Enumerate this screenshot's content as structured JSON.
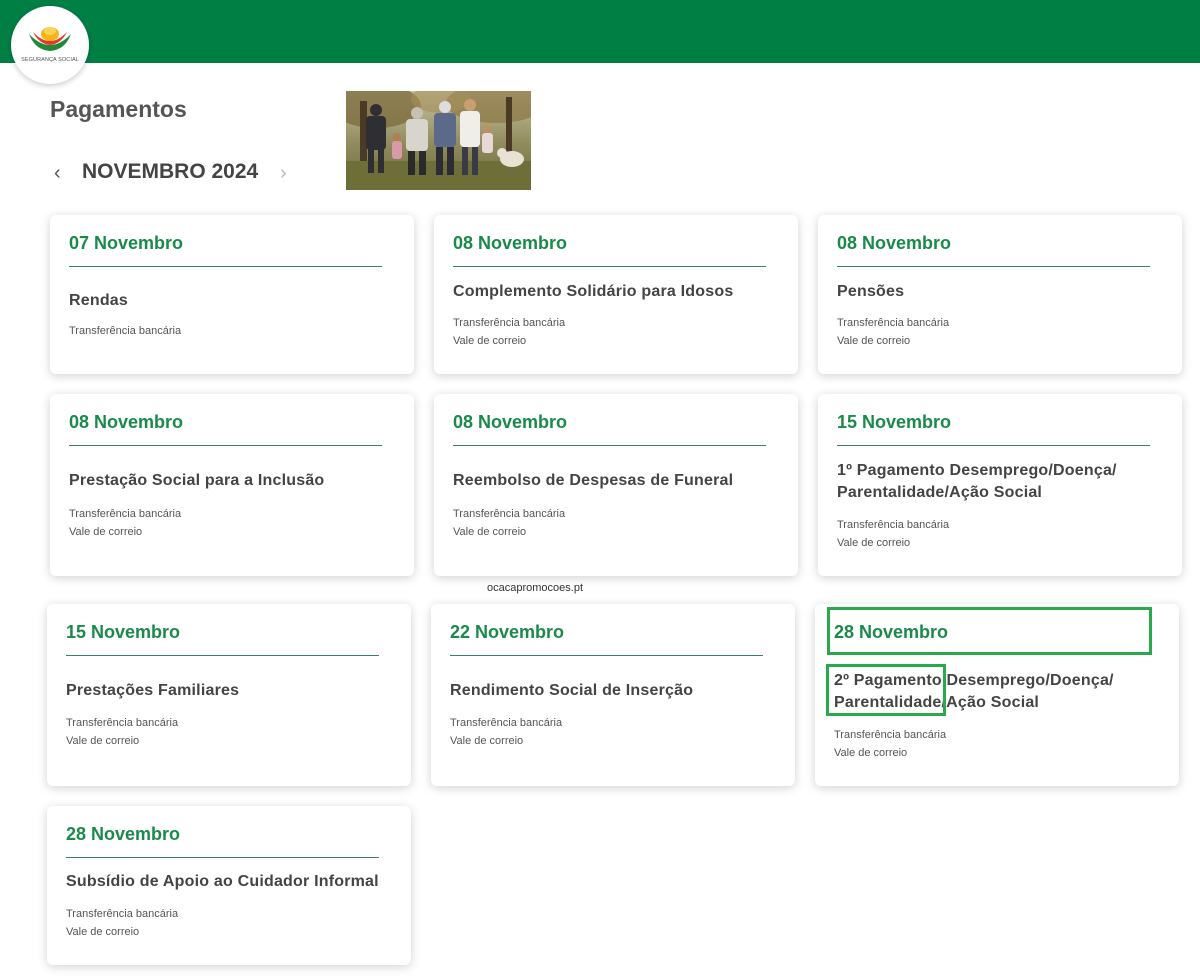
{
  "header": {
    "logo_text": "SEGURANÇA SOCIAL",
    "brand_color": "#007f45"
  },
  "page": {
    "title": "Pagamentos",
    "month": "NOVEMBRO 2024",
    "prev_icon": "chevron-left-icon",
    "next_icon": "chevron-right-icon"
  },
  "watermark": "ocacapromocoes.pt",
  "cards": [
    {
      "date": "07 Novembro",
      "title": "Rendas",
      "methods": [
        "Transferência bancária"
      ]
    },
    {
      "date": "08 Novembro",
      "title": "Complemento Solidário para Idosos",
      "methods": [
        "Transferência bancária",
        "Vale de correio"
      ]
    },
    {
      "date": "08 Novembro",
      "title": "Pensões",
      "methods": [
        "Transferência bancária",
        "Vale de correio"
      ]
    },
    {
      "date": "08 Novembro",
      "title": "Prestação Social para a Inclusão",
      "methods": [
        "Transferência bancária",
        "Vale de correio"
      ]
    },
    {
      "date": "08 Novembro",
      "title": "Reembolso de Despesas de Funeral",
      "methods": [
        "Transferência bancária",
        "Vale de correio"
      ]
    },
    {
      "date": "15 Novembro",
      "title_lines": [
        "1º Pagamento Desemprego/Doença/",
        "Parentalidade/Ação Social"
      ],
      "methods": [
        "Transferência bancária",
        "Vale de correio"
      ]
    },
    {
      "date": "15 Novembro",
      "title": "Prestações Familiares",
      "methods": [
        "Transferência bancária",
        "Vale de correio"
      ]
    },
    {
      "date": "22 Novembro",
      "title": "Rendimento Social de Inserção",
      "methods": [
        "Transferência bancária",
        "Vale de correio"
      ]
    },
    {
      "date": "28 Novembro",
      "title_lines": [
        "2º Pagamento Desemprego/Doença/",
        "Parentalidade/Ação Social"
      ],
      "methods": [
        "Transferência bancária",
        "Vale de correio"
      ]
    },
    {
      "date": "28 Novembro",
      "title": "Subsídio de Apoio ao Cuidador Informal",
      "methods": [
        "Transferência bancária",
        "Vale de correio"
      ]
    }
  ]
}
